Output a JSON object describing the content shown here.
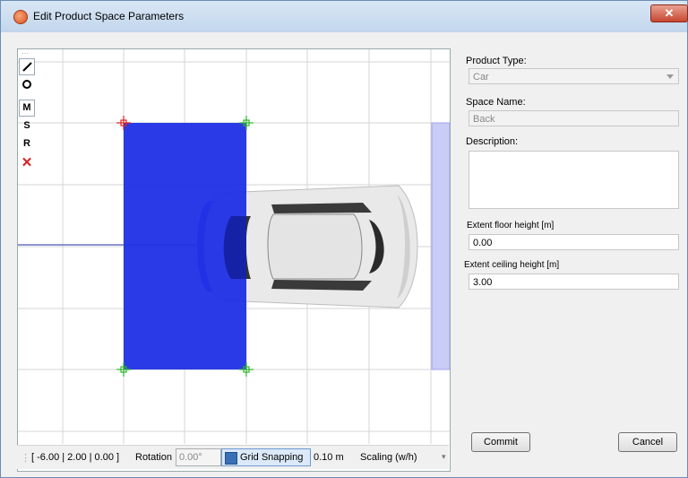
{
  "window": {
    "title": "Edit Product Space Parameters",
    "close_glyph": "✕"
  },
  "toolbar": {
    "tools": [
      {
        "name": "pencil-icon",
        "glyph": ""
      },
      {
        "name": "circle-icon",
        "glyph": ""
      },
      {
        "name": "tool-m",
        "glyph": "M"
      },
      {
        "name": "tool-s",
        "glyph": "S"
      },
      {
        "name": "tool-r",
        "glyph": "R"
      },
      {
        "name": "delete-icon",
        "glyph": "✕"
      }
    ]
  },
  "status": {
    "coordinates": "[ -6.00 | 2.00 | 0.00 ]",
    "rotation_label": "Rotation",
    "rotation_value": "0.00°",
    "grid_snapping_label": "Grid Snapping",
    "grid_size": "0.10 m",
    "scaling_label": "Scaling (w/h)"
  },
  "form": {
    "product_type_label": "Product Type:",
    "product_type_value": "Car",
    "space_name_label": "Space Name:",
    "space_name_value": "Back",
    "description_label": "Description:",
    "description_value": "",
    "floor_label": "Extent floor height [m]",
    "floor_value": "0.00",
    "ceiling_label": "Extent ceiling height [m]",
    "ceiling_value": "3.00",
    "commit_label": "Commit",
    "cancel_label": "Cancel"
  },
  "colors": {
    "space_fill": "#1f2fe6",
    "accent": "#3a6fb6"
  }
}
